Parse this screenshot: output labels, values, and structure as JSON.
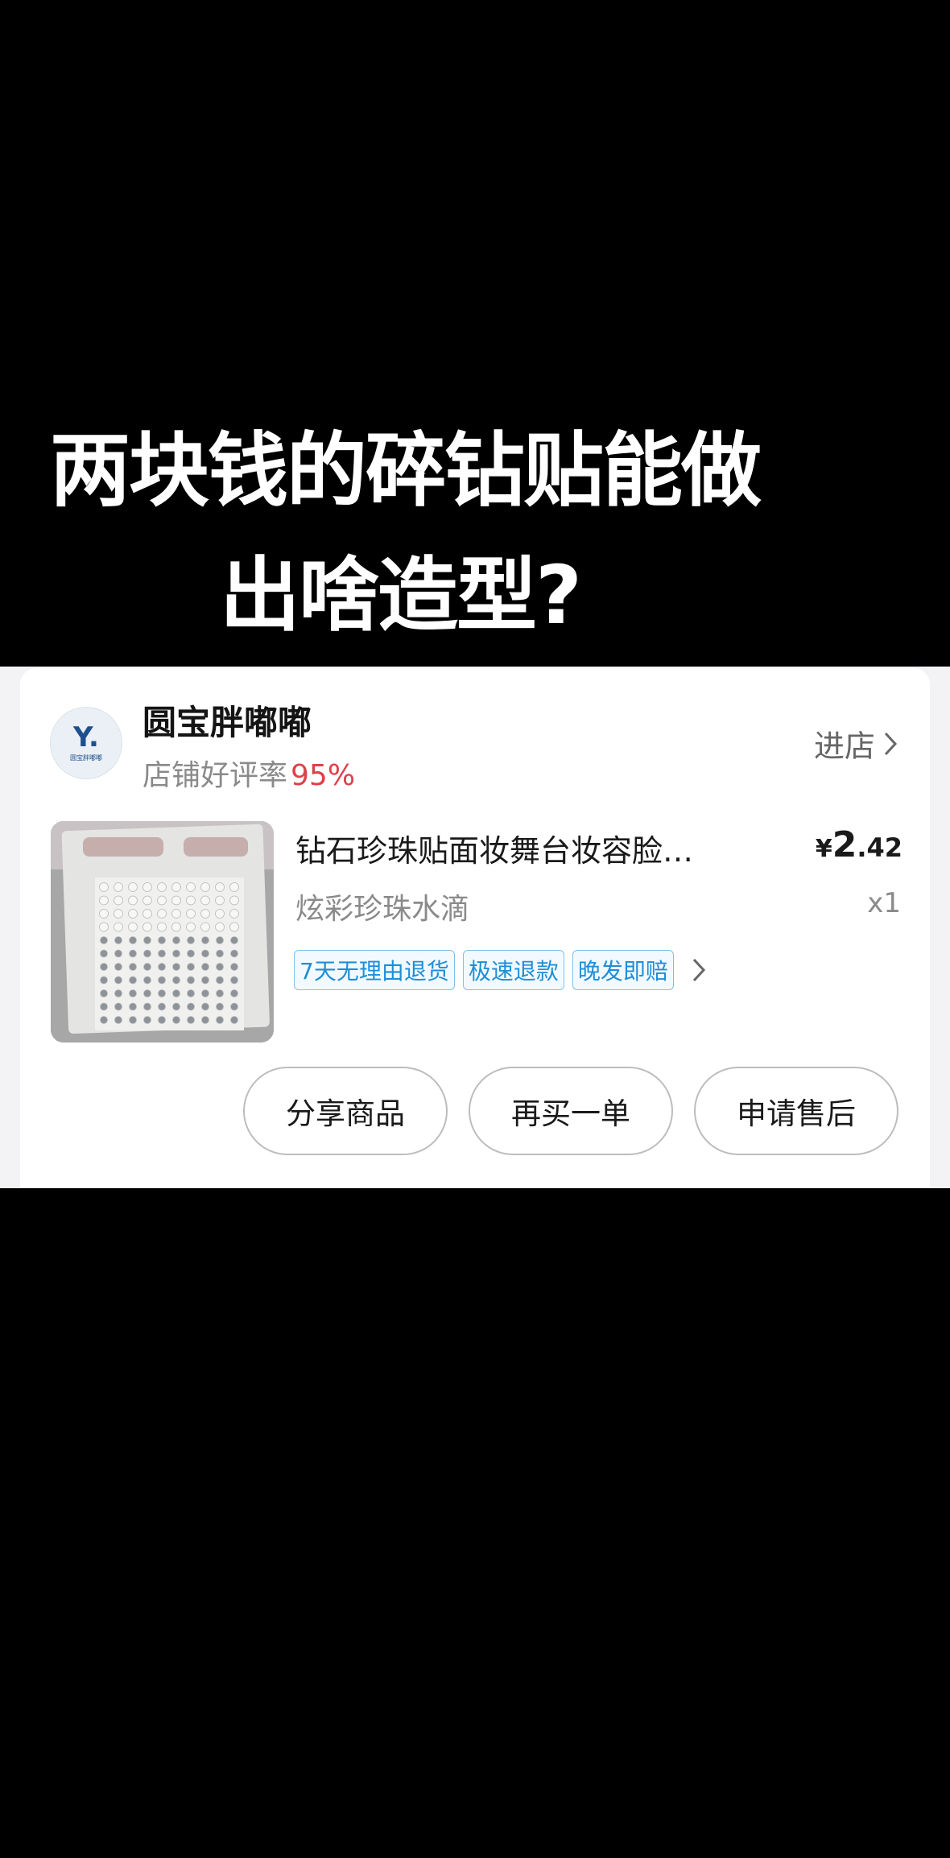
{
  "headline": {
    "line1": "两块钱的碎钻贴能做",
    "line2": "出啥造型?"
  },
  "shop": {
    "logo_letter": "Y.",
    "logo_caption": "圆宝胖嘟嘟",
    "name": "圆宝胖嘟嘟",
    "rating_label": "店铺好评率",
    "rating_value": "95%",
    "visit_label": "进店"
  },
  "product": {
    "title": "钻石珍珠贴面妆舞台妆容脸…",
    "price_symbol": "¥",
    "price_int": "2",
    "price_dec": ".42",
    "variant": "炫彩珍珠水滴",
    "quantity": "x1",
    "tags": [
      "7天无理由退货",
      "极速退款",
      "晚发即赔"
    ]
  },
  "actions": {
    "share": "分享商品",
    "rebuy": "再买一单",
    "after_sale": "申请售后"
  },
  "colors": {
    "accent_red": "#e0404a",
    "tag_blue": "#1f8ed6"
  }
}
